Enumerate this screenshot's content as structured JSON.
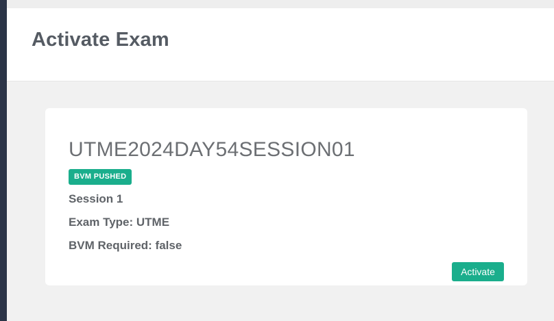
{
  "header": {
    "title": "Activate Exam"
  },
  "exam": {
    "code": "UTME2024DAY54SESSION01",
    "badge": "BVM PUSHED",
    "session": "Session 1",
    "exam_type": "Exam Type: UTME",
    "bvm_required": "BVM Required: false"
  },
  "actions": {
    "activate_label": "Activate"
  },
  "colors": {
    "accent": "#1aae8c",
    "sidebar_edge": "#2b3447",
    "title_text": "#555b63",
    "body_text": "#5f6368"
  }
}
